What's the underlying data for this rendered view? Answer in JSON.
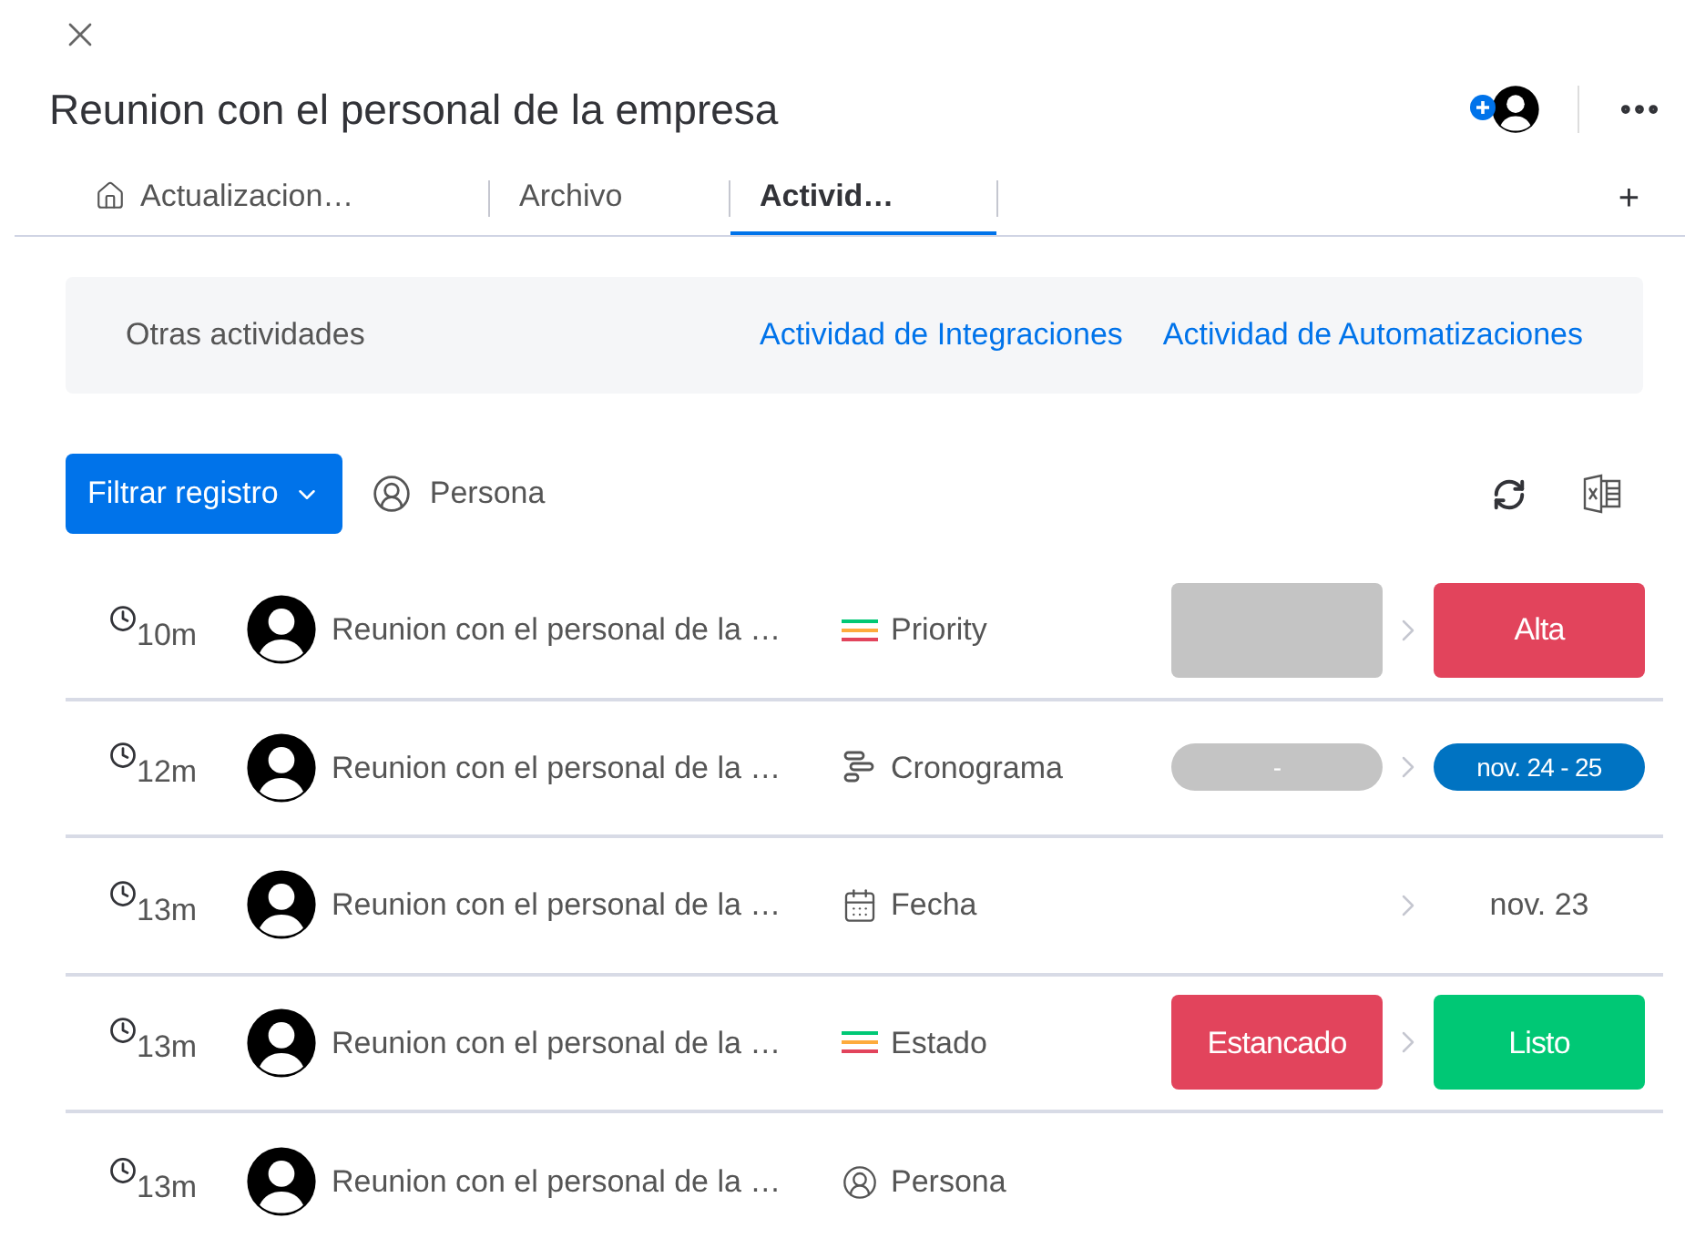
{
  "title": "Reunion con el personal de la empresa",
  "tabs": [
    {
      "label": "Actualizacion…",
      "selected": false,
      "kind": "home"
    },
    {
      "label": "Archivo",
      "selected": false,
      "kind": "plain"
    },
    {
      "label": "Activid…",
      "selected": true,
      "kind": "plain"
    }
  ],
  "add_tab": "+",
  "activity_links": {
    "label": "Otras actividades",
    "links": [
      "Actividad de Integraciones",
      "Actividad de Automatizaciones"
    ]
  },
  "toolbar": {
    "filter_button": "Filtrar registro",
    "person_filter": "Persona"
  },
  "rows": [
    {
      "time": "10m",
      "item": "Reunion con el personal de la …",
      "kind": "status",
      "column": "Priority",
      "old": {
        "kind": "label",
        "color": "#c4c4c4"
      },
      "new": {
        "kind": "label",
        "text": "Alta",
        "color": "#e2445c"
      }
    },
    {
      "time": "12m",
      "item": "Reunion con el personal de la …",
      "kind": "timeline",
      "column": "Cronograma",
      "old": {
        "kind": "pill",
        "text": "-",
        "color": "#c4c4c4"
      },
      "new": {
        "kind": "pill",
        "text": "nov. 24 - 25",
        "color": "#0073c2"
      }
    },
    {
      "time": "13m",
      "item": "Reunion con el personal de la …",
      "kind": "date",
      "column": "Fecha",
      "new": {
        "kind": "plain",
        "text": "nov. 23"
      }
    },
    {
      "time": "13m",
      "item": "Reunion con el personal de la …",
      "kind": "status",
      "column": "Estado",
      "old": {
        "kind": "label",
        "text": "Estancado",
        "color": "#e2445c"
      },
      "new": {
        "kind": "label",
        "text": "Listo",
        "color": "#00c875"
      }
    },
    {
      "time": "13m",
      "item": "Reunion con el personal de la …",
      "kind": "person",
      "column": "Persona"
    }
  ]
}
